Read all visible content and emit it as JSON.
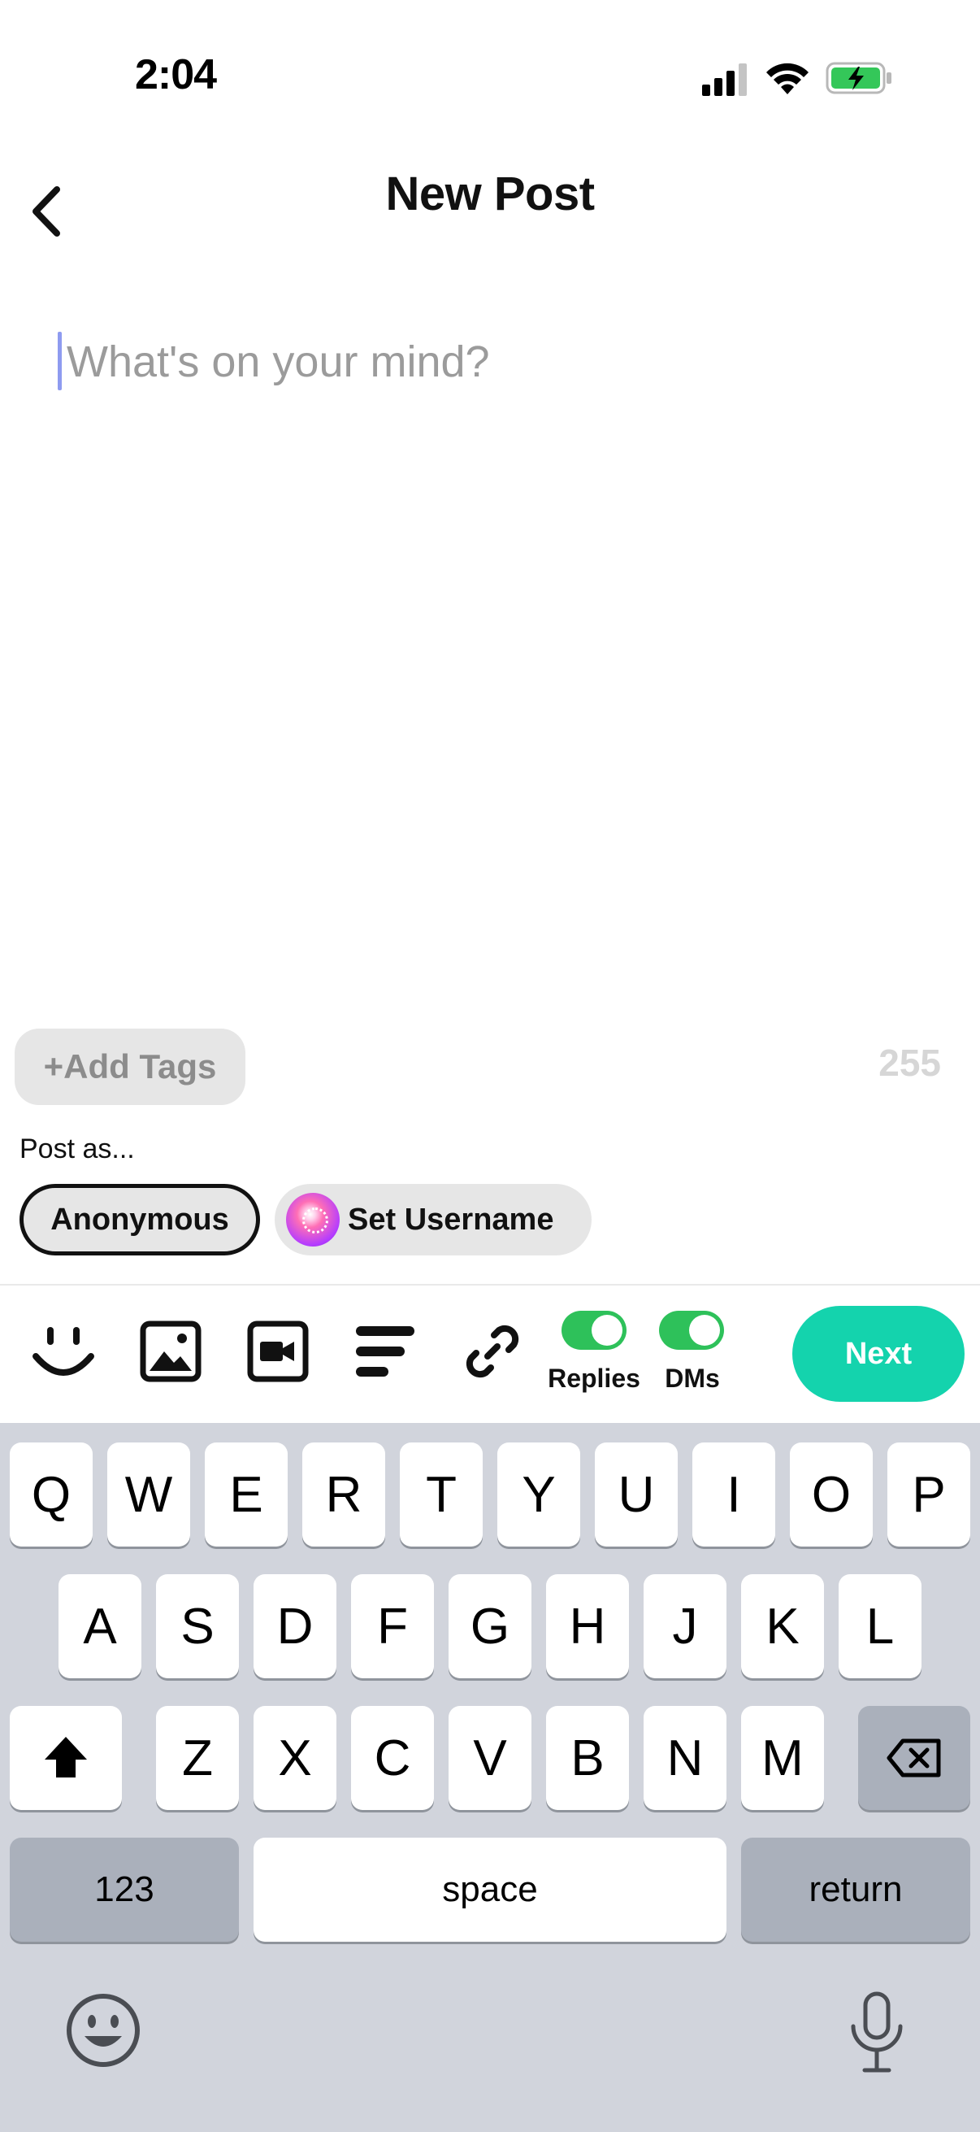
{
  "status_bar": {
    "time": "2:04"
  },
  "header": {
    "title": "New Post"
  },
  "compose": {
    "placeholder": "What's on your mind?"
  },
  "tags": {
    "add_label": "+Add Tags",
    "char_remaining": "255"
  },
  "post_as": {
    "label": "Post as...",
    "options": [
      {
        "label": "Anonymous",
        "selected": true
      },
      {
        "label": "Set Username",
        "selected": false
      }
    ]
  },
  "toolbar": {
    "icons": [
      "emoji-icon",
      "image-icon",
      "video-icon",
      "text-align-icon",
      "link-icon"
    ],
    "replies_label": "Replies",
    "replies_on": true,
    "dms_label": "DMs",
    "dms_on": true,
    "next_label": "Next"
  },
  "keyboard": {
    "row1": [
      "Q",
      "W",
      "E",
      "R",
      "T",
      "Y",
      "U",
      "I",
      "O",
      "P"
    ],
    "row2": [
      "A",
      "S",
      "D",
      "F",
      "G",
      "H",
      "J",
      "K",
      "L"
    ],
    "row3": [
      "Z",
      "X",
      "C",
      "V",
      "B",
      "N",
      "M"
    ],
    "numbers_label": "123",
    "space_label": "space",
    "return_label": "return"
  },
  "colors": {
    "accent": "#14d3ad",
    "toggle_on": "#2ec15a",
    "caret": "#8e9bf0"
  }
}
